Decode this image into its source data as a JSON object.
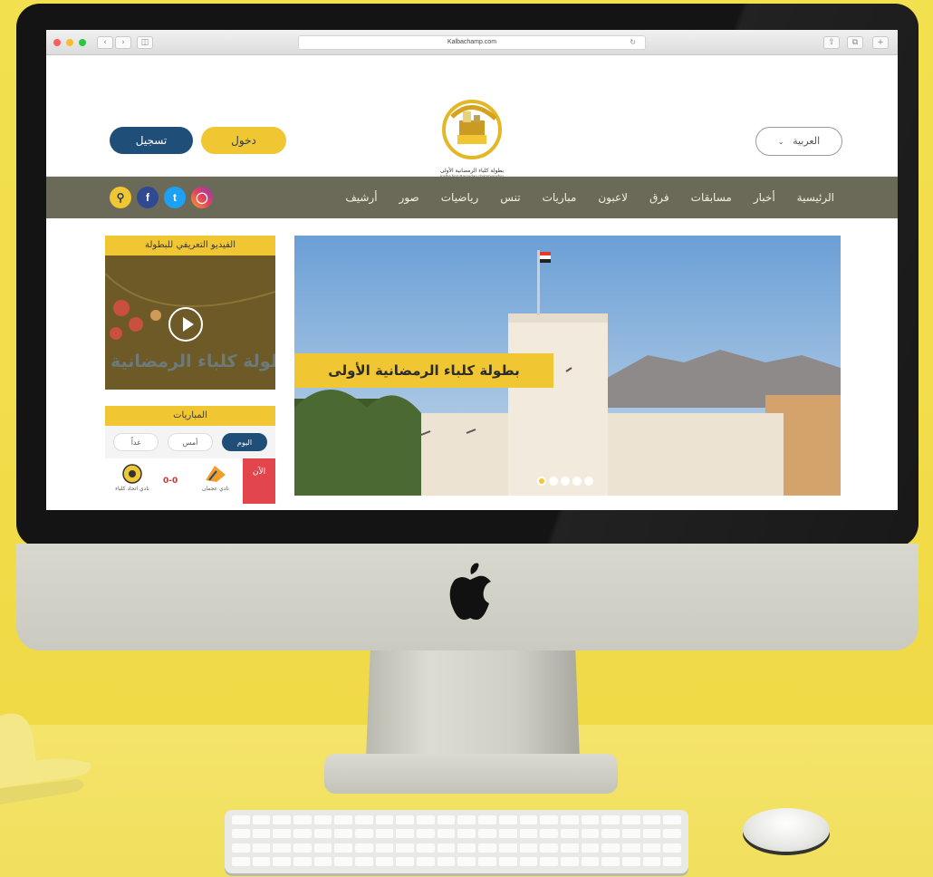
{
  "browser": {
    "url": "Kalbachamp.com"
  },
  "header": {
    "register_label": "تسجيل",
    "login_label": "دخول",
    "language_label": "العربية",
    "logo_caption_ar": "بطولة كلباء الرمضانية الأولى",
    "logo_caption_en": "Kalba first Ramadan championship"
  },
  "nav": {
    "items": [
      "الرئيسية",
      "أخبار",
      "مسابقات",
      "فرق",
      "لاعبون",
      "مباريات",
      "تنس",
      "رياضيات",
      "صور",
      "أرشيف"
    ]
  },
  "social": {
    "icons": [
      "search-icon",
      "facebook-icon",
      "twitter-icon",
      "instagram-icon"
    ]
  },
  "sidebar": {
    "video_title": "الفيديو التعريفي للبطولة",
    "video_text": "بطولة كلباء الرمضانية",
    "matches_title": "المباريات",
    "day_tabs": [
      "اليوم",
      "أمس",
      "غداً"
    ],
    "live_label": "الآن",
    "score": "0-0",
    "team_a": "نادي عجمان",
    "team_b": "نادي اتحاد كلباء"
  },
  "slider": {
    "caption": "بطولة كلباء الرمضانية الأولى",
    "slide_count": 5,
    "active_slide": 1
  },
  "colors": {
    "accent_yellow": "#f1c633",
    "navy": "#1f4e79",
    "nav_bg": "#6b6a58"
  }
}
